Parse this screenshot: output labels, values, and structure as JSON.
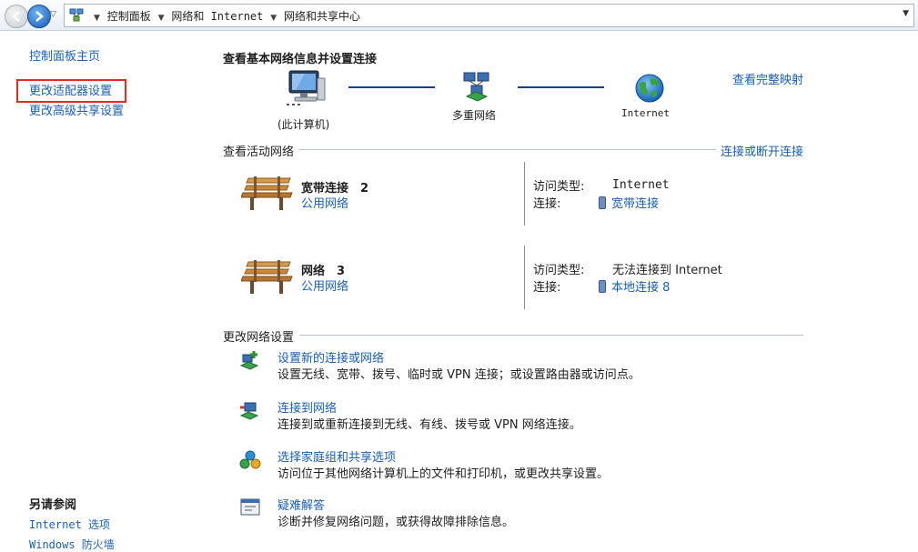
{
  "address": {
    "crumbs": [
      "控制面板",
      "网络和 Internet",
      "网络和共享中心"
    ]
  },
  "sidebar": {
    "home": "控制面板主页",
    "adapter": "更改适配器设置",
    "advanced": "更改高级共享设置",
    "see_also_title": "另请参阅",
    "see_also": [
      "Internet 选项",
      "Windows 防火墙"
    ]
  },
  "main": {
    "title": "查看基本网络信息并设置连接",
    "full_map": "查看完整映射",
    "map": {
      "pc_label": "(此计算机)",
      "multi_label": "多重网络",
      "internet_label": "Internet"
    },
    "active_section": "查看活动网络",
    "connect_disconnect": "连接或断开连接",
    "networks": [
      {
        "name": "宽带连接　2",
        "type": "公用网络",
        "access_label": "访问类型:",
        "access_value": "Internet",
        "conn_label": "连接:",
        "conn_value": "宽带连接"
      },
      {
        "name": "网络　3",
        "type": "公用网络",
        "access_label": "访问类型:",
        "access_value": "无法连接到 Internet",
        "conn_label": "连接:",
        "conn_value": "本地连接 8"
      }
    ],
    "change_section": "更改网络设置",
    "tasks": [
      {
        "title": "设置新的连接或网络",
        "desc": "设置无线、宽带、拨号、临时或 VPN 连接；或设置路由器或访问点。"
      },
      {
        "title": "连接到网络",
        "desc": "连接到或重新连接到无线、有线、拨号或 VPN 网络连接。"
      },
      {
        "title": "选择家庭组和共享选项",
        "desc": "访问位于其他网络计算机上的文件和打印机，或更改共享设置。"
      },
      {
        "title": "疑难解答",
        "desc": "诊断并修复网络问题，或获得故障排除信息。"
      }
    ]
  }
}
